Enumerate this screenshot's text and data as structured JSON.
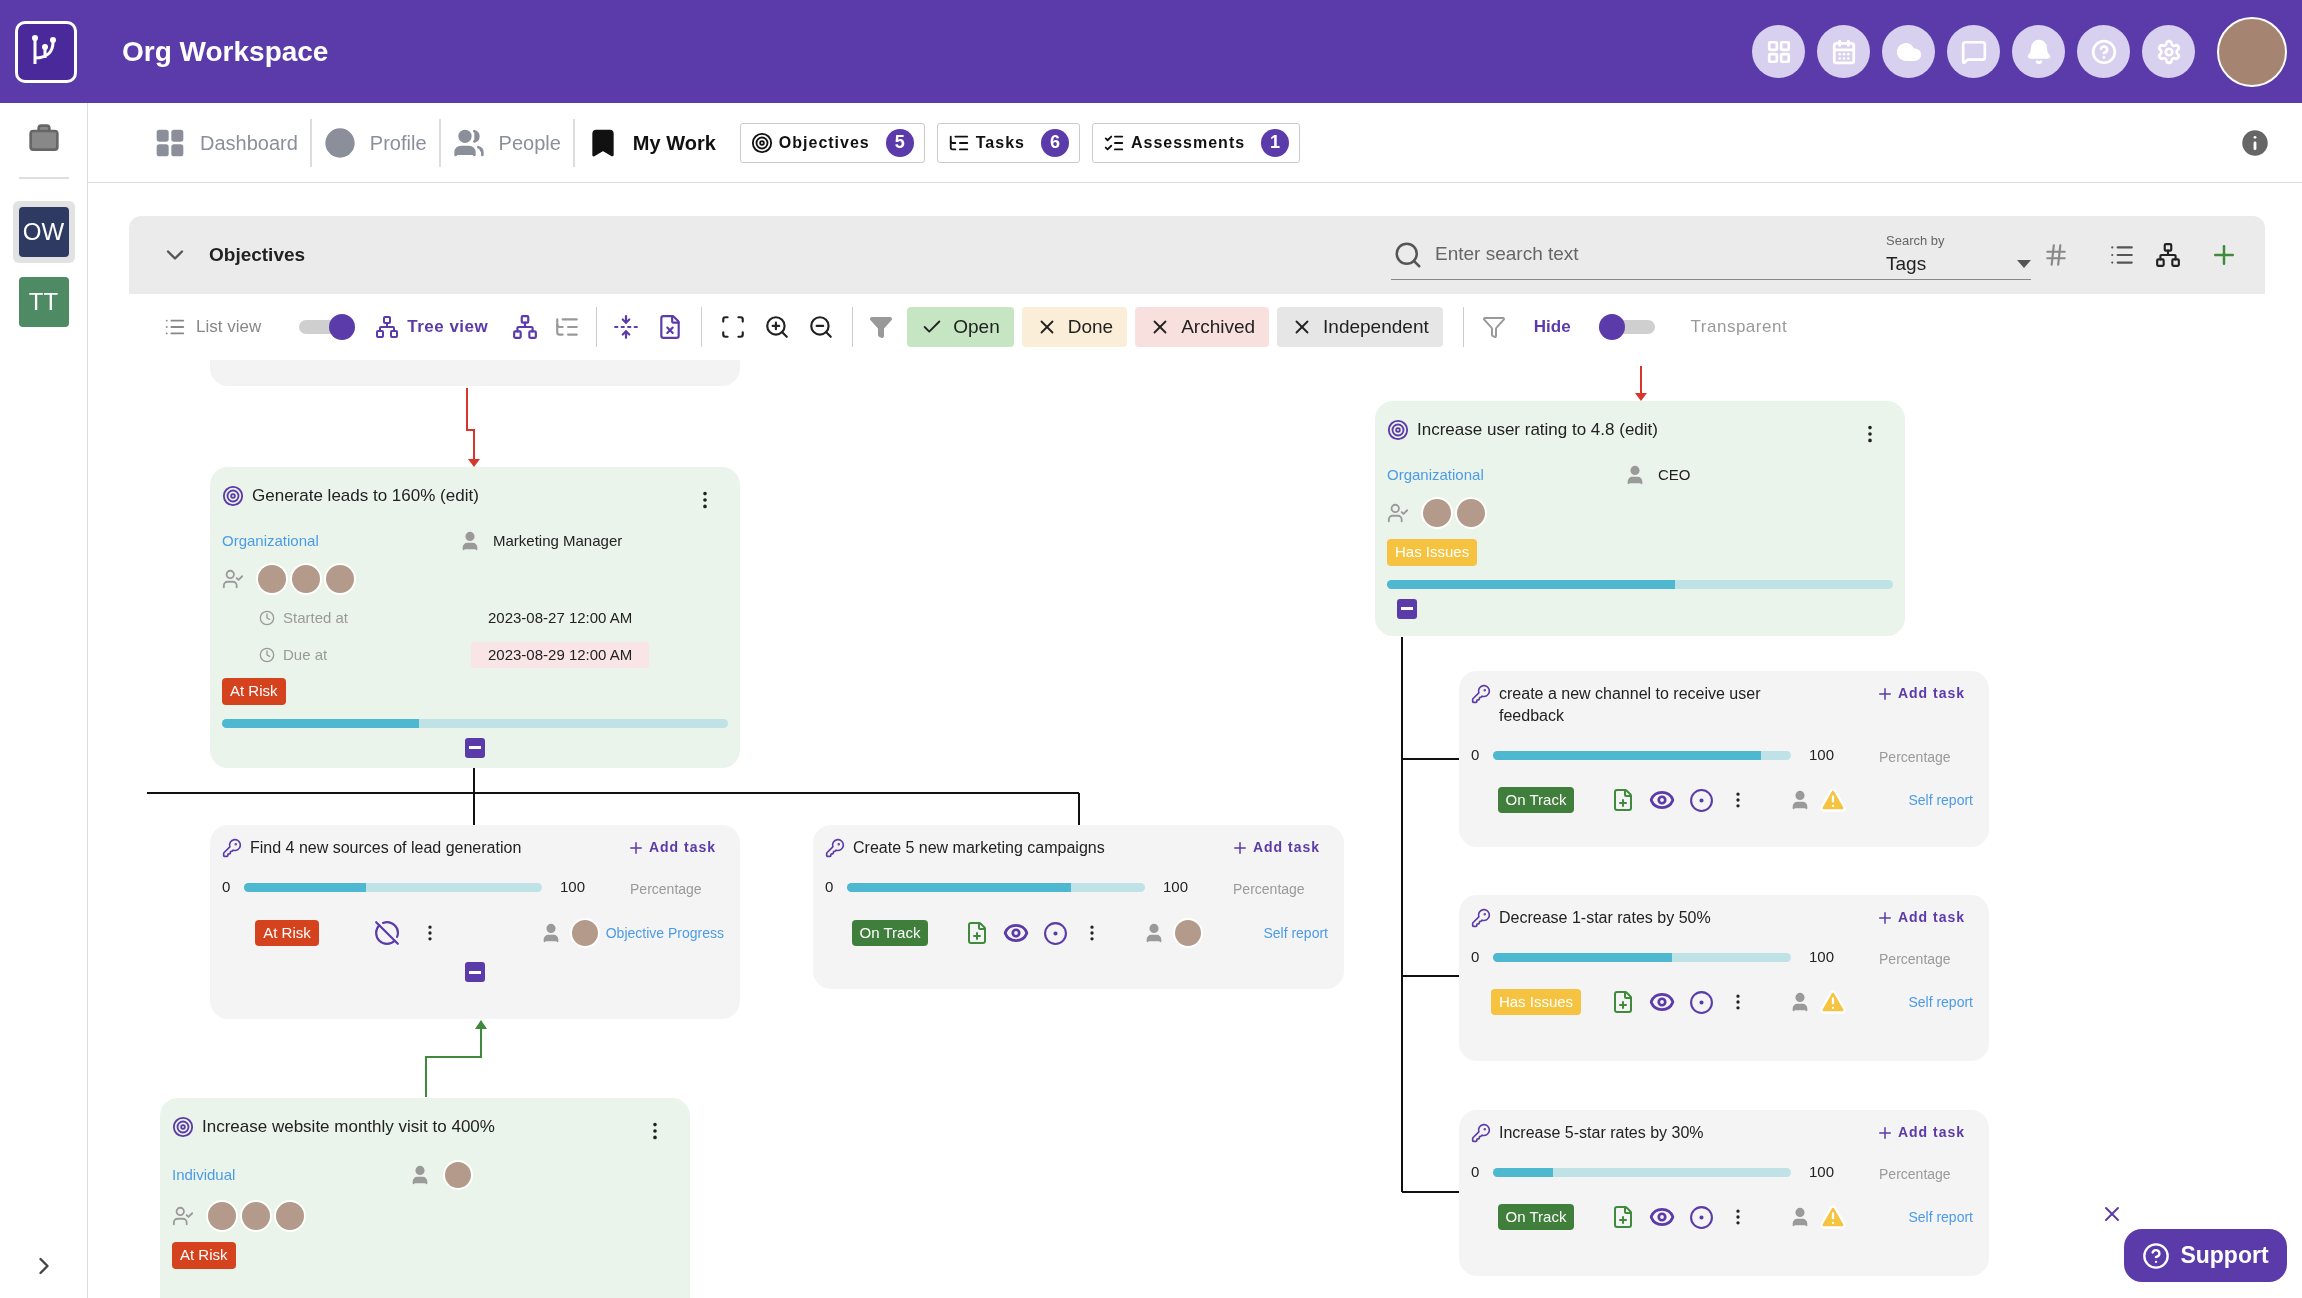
{
  "header": {
    "title": "Org Workspace"
  },
  "sidebar": {
    "items": [
      {
        "label": "OW",
        "selected": true,
        "color": "#2f3a63"
      },
      {
        "label": "TT",
        "selected": false,
        "color": "#4e8a63"
      }
    ]
  },
  "nav": {
    "tabs": [
      {
        "label": "Dashboard",
        "selected": false
      },
      {
        "label": "Profile",
        "selected": false
      },
      {
        "label": "People",
        "selected": false
      },
      {
        "label": "My Work",
        "selected": true
      }
    ],
    "counters": [
      {
        "label": "Objectives",
        "count": "5"
      },
      {
        "label": "Tasks",
        "count": "6"
      },
      {
        "label": "Assessments",
        "count": "1"
      }
    ]
  },
  "panel": {
    "title": "Objectives",
    "search": {
      "placeholder": "Enter search text"
    },
    "search_by": {
      "label": "Search by",
      "value": "Tags"
    }
  },
  "toolbar": {
    "list_view": "List view",
    "tree_view": {
      "label": "Tree view",
      "on": true
    },
    "filters": [
      {
        "label": "Open",
        "selected": true,
        "color": "#c6e5c2"
      },
      {
        "label": "Done",
        "selected": false,
        "color": "#fbeed9"
      },
      {
        "label": "Archived",
        "selected": false,
        "color": "#f8e0df"
      },
      {
        "label": "Independent",
        "selected": false,
        "color": "#e6e6e6"
      }
    ],
    "hide": {
      "label": "Hide",
      "transparent_label": "Transparent",
      "transparent": false
    }
  },
  "objectives": [
    {
      "title": "Generate leads to 160% (edit)",
      "scope": "Organizational",
      "owner": {
        "kind": "role",
        "label": "Marketing Manager"
      },
      "members": [
        {
          "kind": "avatar"
        },
        {
          "kind": "avatar"
        },
        {
          "kind": "avatar"
        }
      ],
      "dates": [
        {
          "label": "Started at",
          "value": "2023-08-27 12:00 AM",
          "overdue": false
        },
        {
          "label": "Due at",
          "value": "2023-08-29 12:00 AM",
          "overdue": true
        }
      ],
      "status": {
        "label": "At Risk",
        "color": "#d4421e"
      },
      "level": 0.39,
      "expanded": true
    },
    {
      "title": "Increase website monthly visit to 400%",
      "scope": "Individual",
      "owner": {
        "kind": "avatar"
      },
      "members": [
        {
          "kind": "avatar"
        },
        {
          "kind": "avatar"
        },
        {
          "kind": "avatar"
        }
      ],
      "status": {
        "label": "At Risk",
        "color": "#d4421e"
      }
    },
    {
      "title": "Increase user rating to 4.8 (edit)",
      "scope": "Organizational",
      "owner": {
        "kind": "role",
        "label": "CEO"
      },
      "members": [
        {
          "kind": "avatar"
        },
        {
          "kind": "avatar"
        }
      ],
      "status": {
        "label": "Has Issues",
        "color": "#f5c340"
      },
      "level": 0.57,
      "expanded": true
    }
  ],
  "key_results": [
    {
      "title": "Find 4 new sources of lead generation",
      "add_task": "Add task",
      "min": "0",
      "max": "100",
      "unit": "Percentage",
      "level": 0.41,
      "status": {
        "label": "At Risk",
        "color": "#d4421e"
      },
      "kind": "linked",
      "assignee": {
        "kind": "avatar"
      },
      "report": "Objective Progress",
      "expanded": true
    },
    {
      "title": "Create 5 new marketing campaigns",
      "add_task": "Add task",
      "min": "0",
      "max": "100",
      "unit": "Percentage",
      "level": 0.75,
      "status": {
        "label": "On Track",
        "color": "#3f7f3b"
      },
      "kind": "self",
      "assignee": {
        "kind": "avatar"
      },
      "report": "Self report"
    },
    {
      "title": "create a new channel to receive user feedback",
      "add_task": "Add task",
      "min": "0",
      "max": "100",
      "unit": "Percentage",
      "level": 0.9,
      "status": {
        "label": "On Track",
        "color": "#3f7f3b"
      },
      "kind": "self",
      "assignee": {
        "kind": "warning"
      },
      "report": "Self report"
    },
    {
      "title": "Decrease 1-star rates by 50%",
      "add_task": "Add task",
      "min": "0",
      "max": "100",
      "unit": "Percentage",
      "level": 0.6,
      "status": {
        "label": "Has Issues",
        "color": "#f5c340"
      },
      "kind": "self",
      "assignee": {
        "kind": "warning"
      },
      "report": "Self report"
    },
    {
      "title": "Increase 5-star rates by 30%",
      "add_task": "Add task",
      "min": "0",
      "max": "100",
      "unit": "Percentage",
      "level": 0.2,
      "status": {
        "label": "On Track",
        "color": "#3f7f3b"
      },
      "kind": "self",
      "assignee": {
        "kind": "warning"
      },
      "report": "Self report"
    }
  ],
  "support": {
    "label": "Support"
  }
}
